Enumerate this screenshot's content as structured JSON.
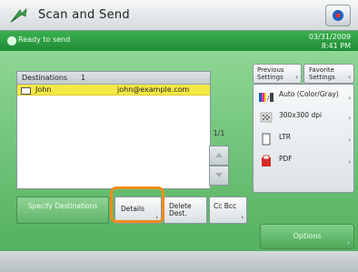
{
  "title_bar": {
    "title": "Scan and Send"
  },
  "status_bar": {
    "message": "Ready to send",
    "date": "03/31/2009",
    "time": "8:41 PM"
  },
  "destinations": {
    "header_label": "Destinations",
    "header_count": "1",
    "rows": [
      {
        "name": "John",
        "address": "john@example.com"
      }
    ],
    "page_indicator": "1/1"
  },
  "right_buttons": {
    "previous_settings": "Previous Settings",
    "favorite_settings": "Favorite Settings"
  },
  "settings": [
    {
      "icon": "color-mode-icon",
      "label": "Auto (Color/Gray)"
    },
    {
      "icon": "resolution-icon",
      "label": "300x300 dpi"
    },
    {
      "icon": "paper-size-icon",
      "label": "LTR"
    },
    {
      "icon": "pdf-icon",
      "label": "PDF"
    }
  ],
  "bottom_buttons": {
    "specify_destinations": "Specify Destinations",
    "details": "Details",
    "delete_dest": "Delete Dest.",
    "cc_bcc": "Cc Bcc"
  },
  "send_button": "Options",
  "colors": {
    "highlight": "#f08c1a",
    "selected_row": "#f4e845",
    "status_green": "#2a9a3f"
  }
}
